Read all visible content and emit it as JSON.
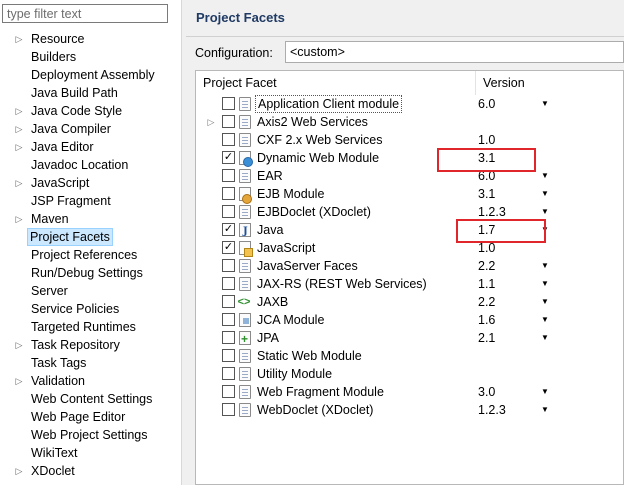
{
  "left": {
    "filter_placeholder": "type filter text",
    "items": [
      {
        "label": "Resource",
        "expandable": true
      },
      {
        "label": "Builders",
        "expandable": false
      },
      {
        "label": "Deployment Assembly",
        "expandable": false
      },
      {
        "label": "Java Build Path",
        "expandable": false
      },
      {
        "label": "Java Code Style",
        "expandable": true
      },
      {
        "label": "Java Compiler",
        "expandable": true
      },
      {
        "label": "Java Editor",
        "expandable": true
      },
      {
        "label": "Javadoc Location",
        "expandable": false
      },
      {
        "label": "JavaScript",
        "expandable": true
      },
      {
        "label": "JSP Fragment",
        "expandable": false
      },
      {
        "label": "Maven",
        "expandable": true
      },
      {
        "label": "Project Facets",
        "expandable": false,
        "selected": true
      },
      {
        "label": "Project References",
        "expandable": false
      },
      {
        "label": "Run/Debug Settings",
        "expandable": false
      },
      {
        "label": "Server",
        "expandable": false
      },
      {
        "label": "Service Policies",
        "expandable": false
      },
      {
        "label": "Targeted Runtimes",
        "expandable": false
      },
      {
        "label": "Task Repository",
        "expandable": true
      },
      {
        "label": "Task Tags",
        "expandable": false
      },
      {
        "label": "Validation",
        "expandable": true
      },
      {
        "label": "Web Content Settings",
        "expandable": false
      },
      {
        "label": "Web Page Editor",
        "expandable": false
      },
      {
        "label": "Web Project Settings",
        "expandable": false
      },
      {
        "label": "WikiText",
        "expandable": false
      },
      {
        "label": "XDoclet",
        "expandable": true
      }
    ]
  },
  "right": {
    "title": "Project Facets",
    "config_label": "Configuration:",
    "config_value": "<custom>",
    "col_facet": "Project Facet",
    "col_version": "Version",
    "facets": [
      {
        "name": "Application Client module",
        "version": "6.0",
        "checked": false,
        "dropdown": true,
        "icon": "doc-icon"
      },
      {
        "name": "Axis2 Web Services",
        "version": "",
        "checked": false,
        "dropdown": false,
        "expandable": true,
        "icon": "doc-icon"
      },
      {
        "name": "CXF 2.x Web Services",
        "version": "1.0",
        "checked": false,
        "dropdown": false,
        "icon": "doc-icon"
      },
      {
        "name": "Dynamic Web Module",
        "version": "3.1",
        "checked": true,
        "dropdown": false,
        "highlight": true,
        "icon": "web-module-icon"
      },
      {
        "name": "EAR",
        "version": "6.0",
        "checked": false,
        "dropdown": true,
        "icon": "doc-icon"
      },
      {
        "name": "EJB Module",
        "version": "3.1",
        "checked": false,
        "dropdown": true,
        "icon": "ejb-icon"
      },
      {
        "name": "EJBDoclet (XDoclet)",
        "version": "1.2.3",
        "checked": false,
        "dropdown": true,
        "icon": "doc-icon"
      },
      {
        "name": "Java",
        "version": "1.7",
        "checked": true,
        "dropdown": true,
        "highlight": true,
        "icon": "java-icon"
      },
      {
        "name": "JavaScript",
        "version": "1.0",
        "checked": true,
        "dropdown": false,
        "icon": "javascript-icon"
      },
      {
        "name": "JavaServer Faces",
        "version": "2.2",
        "checked": false,
        "dropdown": true,
        "icon": "doc-icon"
      },
      {
        "name": "JAX-RS (REST Web Services)",
        "version": "1.1",
        "checked": false,
        "dropdown": true,
        "icon": "doc-icon"
      },
      {
        "name": "JAXB",
        "version": "2.2",
        "checked": false,
        "dropdown": true,
        "icon": "jaxb-icon"
      },
      {
        "name": "JCA Module",
        "version": "1.6",
        "checked": false,
        "dropdown": true,
        "icon": "jca-icon"
      },
      {
        "name": "JPA",
        "version": "2.1",
        "checked": false,
        "dropdown": true,
        "icon": "jpa-icon"
      },
      {
        "name": "Static Web Module",
        "version": "",
        "checked": false,
        "dropdown": false,
        "icon": "doc-icon"
      },
      {
        "name": "Utility Module",
        "version": "",
        "checked": false,
        "dropdown": false,
        "icon": "doc-icon"
      },
      {
        "name": "Web Fragment Module",
        "version": "3.0",
        "checked": false,
        "dropdown": true,
        "icon": "doc-icon"
      },
      {
        "name": "WebDoclet (XDoclet)",
        "version": "1.2.3",
        "checked": false,
        "dropdown": true,
        "icon": "doc-icon"
      }
    ]
  },
  "colors": {
    "selection": "#cce8ff",
    "highlight_box": "#e0262a",
    "title": "#1f3a64"
  }
}
